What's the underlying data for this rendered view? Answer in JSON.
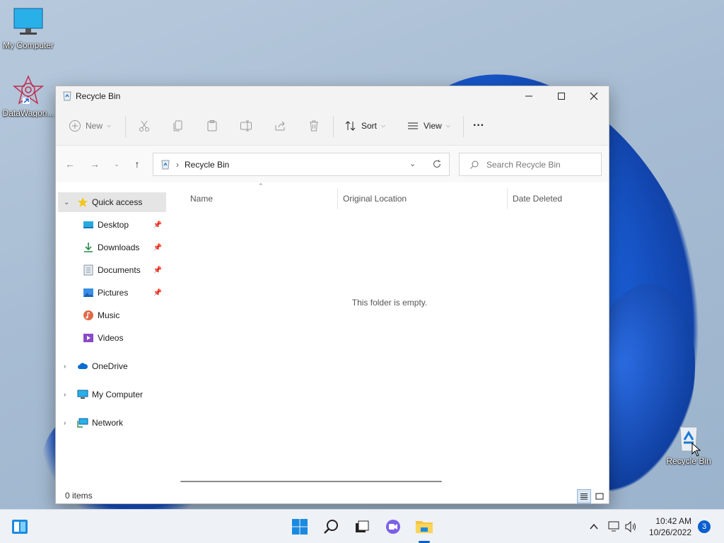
{
  "desktop": {
    "icons": [
      {
        "label": "My Computer"
      },
      {
        "label": "DataWagon..."
      },
      {
        "label": "Recycle Bin"
      }
    ]
  },
  "window": {
    "title": "Recycle Bin",
    "toolbar": {
      "new_label": "New",
      "sort_label": "Sort",
      "view_label": "View",
      "more_label": "···"
    },
    "address": {
      "breadcrumb": "Recycle Bin",
      "search_placeholder": "Search Recycle Bin"
    },
    "nav": {
      "quick_access": "Quick access",
      "items": [
        {
          "label": "Desktop"
        },
        {
          "label": "Downloads"
        },
        {
          "label": "Documents"
        },
        {
          "label": "Pictures"
        },
        {
          "label": "Music"
        },
        {
          "label": "Videos"
        }
      ],
      "onedrive": "OneDrive",
      "my_computer": "My Computer",
      "network": "Network"
    },
    "columns": [
      "Name",
      "Original Location",
      "Date Deleted"
    ],
    "empty_message": "This folder is empty.",
    "status": "0 items"
  },
  "taskbar": {
    "time": "10:42 AM",
    "date": "10/26/2022",
    "notifications": "3"
  },
  "colors": {
    "accent": "#0a5fce",
    "wallpaper_bloom": "#1a5fd8"
  }
}
